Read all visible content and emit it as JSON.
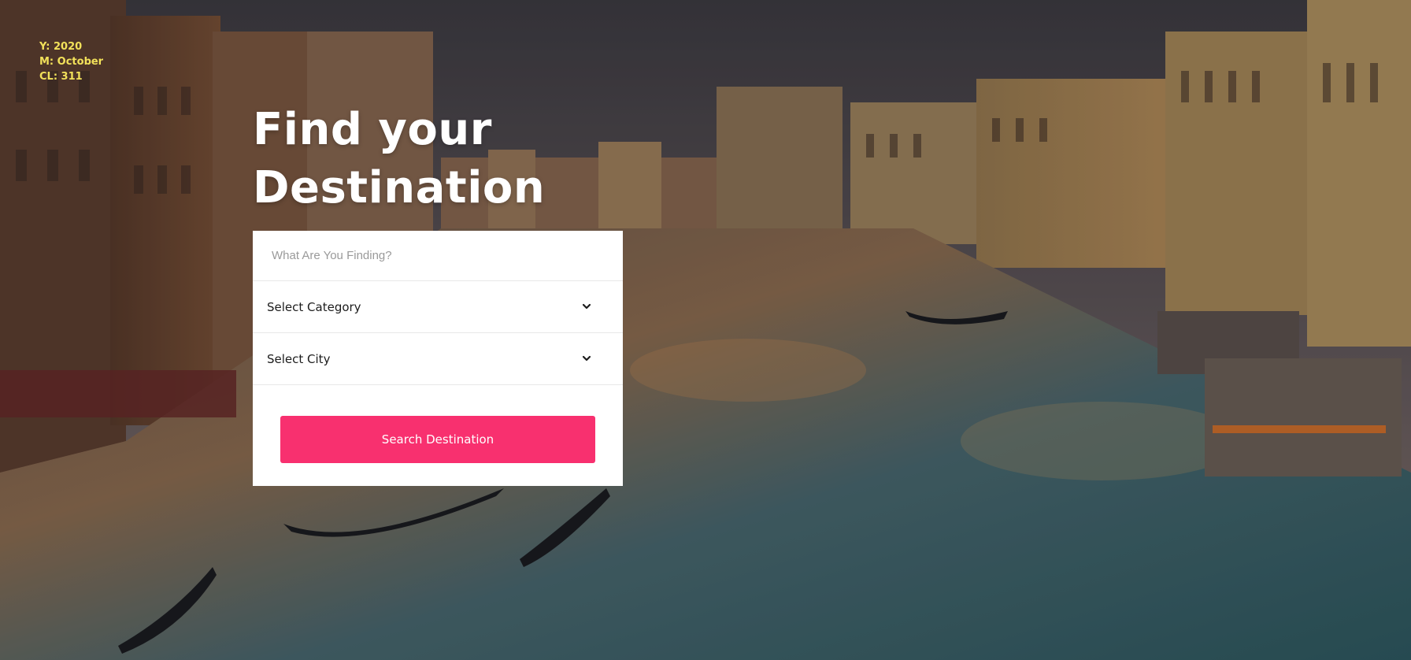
{
  "overlay": {
    "year": "Y: 2020",
    "month": "M: October",
    "cl": "CL: 311"
  },
  "hero": {
    "title_line1": "Find your",
    "title_line2": "Destination"
  },
  "search": {
    "placeholder": "What Are You Finding?",
    "category_label": "Select Category",
    "city_label": "Select City",
    "button_label": "Search Destination"
  },
  "colors": {
    "accent": "#f8306f",
    "overlay_text": "#f2e15a"
  },
  "icons": {
    "dropdown": "chevron-down-icon"
  }
}
